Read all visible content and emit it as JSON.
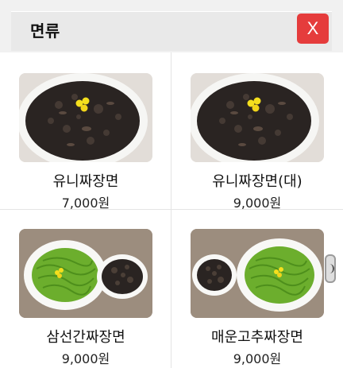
{
  "header": {
    "title": "면류",
    "close_label": "X"
  },
  "menu": {
    "items": [
      {
        "name": "유니짜장면",
        "price": "7,000원",
        "image": "jjajang-bowl-icon"
      },
      {
        "name": "유니짜장면(대)",
        "price": "9,000원",
        "image": "jjajang-bowl-icon"
      },
      {
        "name": "삼선간짜장면",
        "price": "9,000원",
        "image": "green-noodle-with-sauce-icon"
      },
      {
        "name": "매운고추짜장면",
        "price": "9,000원",
        "image": "green-noodle-with-sauce-icon"
      }
    ]
  },
  "colors": {
    "close_button": "#e53c3c",
    "header_bg": "#e9e9e9",
    "noodle_green": "#6cae2d",
    "sauce_dark": "#2b2422"
  }
}
